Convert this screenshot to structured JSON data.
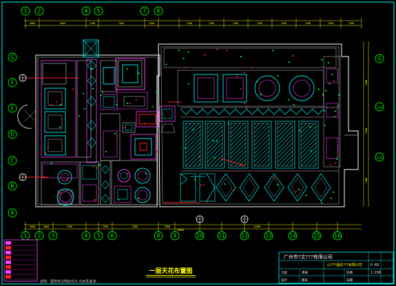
{
  "colors": {
    "background": "#000000",
    "frame": "#00ffff",
    "wall": "#ffffff",
    "wall_alt": "#c8c8c8",
    "axis_bubble": "#00ff00",
    "dimension": "#ffff00",
    "fixture_red": "#ff2020",
    "fixture_magenta": "#ff40ff",
    "fixture_green": "#00ff40",
    "ceiling_cyan": "#00e0e0",
    "title_yellow": "#ffff00"
  },
  "grid_axes": {
    "top": [
      "1",
      "2",
      "4",
      "5",
      "7",
      "8"
    ],
    "bottom": [
      "1",
      "2",
      "3",
      "4",
      "5",
      "6",
      "8",
      "9",
      "10",
      "11",
      "12",
      "13",
      "14",
      "15",
      "16"
    ],
    "left": [
      "G",
      "F",
      "E",
      "D",
      "C",
      "B",
      "A"
    ],
    "right": [
      "G",
      "1/4",
      "1/4"
    ]
  },
  "dimension_numbers": {
    "top": [
      "3000",
      "2000",
      "7500",
      "7500",
      "7500",
      "7500",
      "7500",
      "7500",
      "7500",
      "7500",
      "7500",
      "7500",
      "7500"
    ],
    "bottom": [
      "3000",
      "3000",
      "7500",
      "7500",
      "2000",
      "7800"
    ],
    "bottom_total": "40000",
    "bottom_right": "24500",
    "right": [
      "7500",
      "7500",
      "7500"
    ]
  },
  "title_block": {
    "company": "广州市?文???有限公司",
    "project_name": "山???酒店???有限公司",
    "drawing_name": "一层天花布置图",
    "drawing_no": "P-03",
    "scale": "1:150",
    "cell_labels": [
      "工程",
      "设计",
      "审核",
      "图号",
      "比例",
      "日期"
    ]
  },
  "drawing_title": "一层天花布置图",
  "note_text": "说明：图例未注明处均为 白色乳胶漆 ...",
  "legend_rows": [
    "",
    "",
    "",
    "",
    "",
    "",
    "",
    ""
  ]
}
